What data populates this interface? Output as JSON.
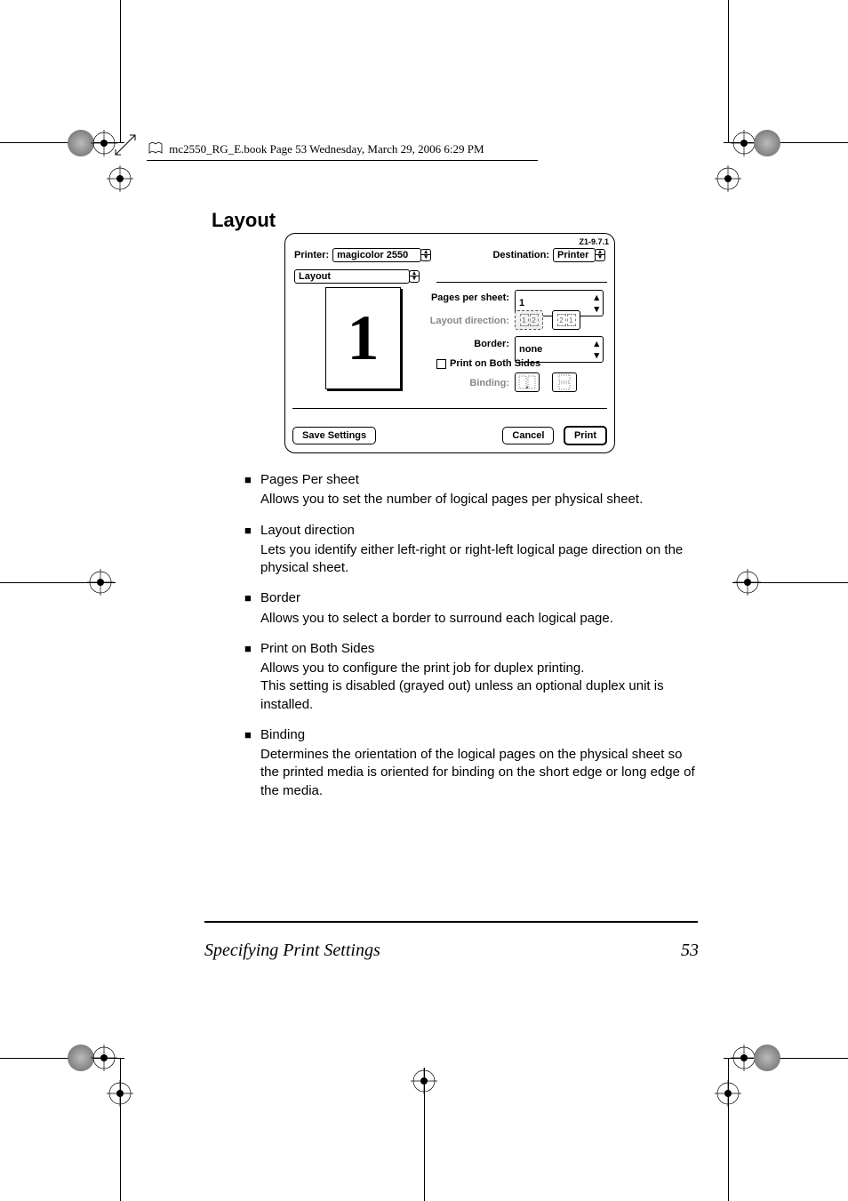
{
  "header": {
    "path_text": "mc2550_RG_E.book  Page 53  Wednesday, March 29, 2006  6:29 PM"
  },
  "section": {
    "title": "Layout"
  },
  "dialog": {
    "version": "Z1-9.7.1",
    "printer_label": "Printer:",
    "printer_value": "magicolor 2550",
    "destination_label": "Destination:",
    "destination_value": "Printer",
    "panel_value": "Layout",
    "pages_per_sheet_label": "Pages per sheet:",
    "pages_per_sheet_value": "1",
    "layout_direction_label": "Layout direction:",
    "border_label": "Border:",
    "border_value": "none",
    "print_both_sides_label": "Print on Both Sides",
    "binding_label": "Binding:",
    "save_settings": "Save Settings",
    "cancel": "Cancel",
    "print": "Print",
    "preview_glyph": "1",
    "dir_lr_1": "1",
    "dir_lr_2": "2",
    "dir_rl_1": "2",
    "dir_rl_2": "1"
  },
  "bullets": [
    {
      "title": "Pages Per sheet",
      "body": "Allows you to set the number of logical pages per physical sheet."
    },
    {
      "title": "Layout direction",
      "body": "Lets you identify either left-right or right-left logical page direction on the physical sheet."
    },
    {
      "title": "Border",
      "body": "Allows you to select a border to surround each logical page."
    },
    {
      "title": "Print on Both Sides",
      "body": "Allows you to configure the print job for duplex printing.\nThis setting is disabled (grayed out) unless an optional duplex unit is installed."
    },
    {
      "title": "Binding",
      "body": "Determines the orientation of the logical pages on the physical sheet so the printed media is oriented for binding on the short edge or long edge of the media."
    }
  ],
  "footer": {
    "text": "Specifying Print Settings",
    "page_num": "53"
  }
}
